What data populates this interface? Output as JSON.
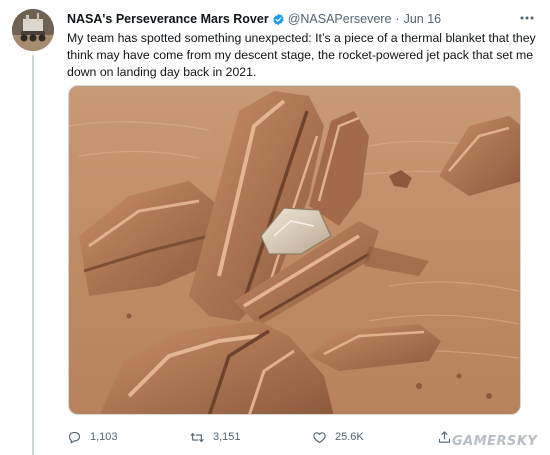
{
  "tweet": {
    "author_name": "NASA's Perseverance Mars Rover",
    "handle": "@NASAPersevere",
    "separator": "·",
    "date": "Jun 16",
    "more_icon": "more-horizontal-icon",
    "verified_icon": "verified-badge-icon",
    "verified_color": "#1d9bf0",
    "text": "My team has spotted something unexpected: It’s a piece of a thermal blanket that they think may have come from my descent stage, the rocket-powered jet pack that set me down on landing day back in 2021.",
    "media": {
      "subject": "Mars rocks with a piece of thermal blanket"
    }
  },
  "actions": {
    "reply_icon": "reply-icon",
    "reply_count": "1,103",
    "retweet_icon": "retweet-icon",
    "retweet_count": "3,151",
    "like_icon": "like-icon",
    "like_count": "25.6K",
    "share_icon": "share-icon"
  },
  "watermark": {
    "text": "GAMERSKY"
  },
  "colors": {
    "text_primary": "#0f1419",
    "text_secondary": "#536471",
    "border": "#cfd9de"
  }
}
